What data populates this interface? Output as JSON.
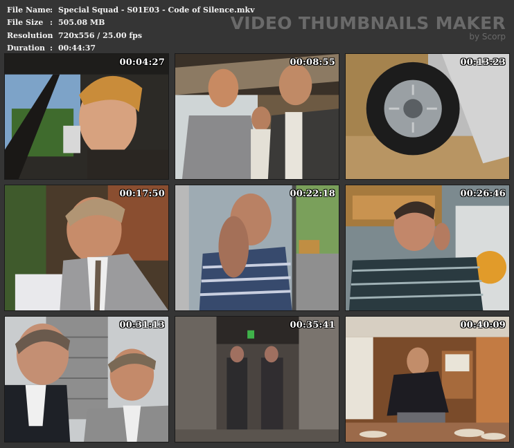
{
  "file_info": {
    "rows": [
      {
        "label": "File Name",
        "value": "Special Squad - S01E03 - Code of Silence.mkv"
      },
      {
        "label": "File Size",
        "value": "505.08 MB"
      },
      {
        "label": "Resolution",
        "value": "720x556 / 25.00 fps"
      },
      {
        "label": "Duration",
        "value": "00:44:37"
      }
    ],
    "separator": ":"
  },
  "brand": {
    "title": "VIDEO THUMBNAILS MAKER",
    "subtitle": "by Scorp"
  },
  "thumbnails": [
    {
      "timestamp": "00:04:27"
    },
    {
      "timestamp": "00:08:55"
    },
    {
      "timestamp": "00:13:23"
    },
    {
      "timestamp": "00:17:50"
    },
    {
      "timestamp": "00:22:18"
    },
    {
      "timestamp": "00:26:46"
    },
    {
      "timestamp": "00:31:13"
    },
    {
      "timestamp": "00:35:41"
    },
    {
      "timestamp": "00:40:09"
    }
  ],
  "colors": {
    "background": "#353535",
    "brand_text": "#6a6a6a",
    "info_text": "#f2f2f2"
  }
}
